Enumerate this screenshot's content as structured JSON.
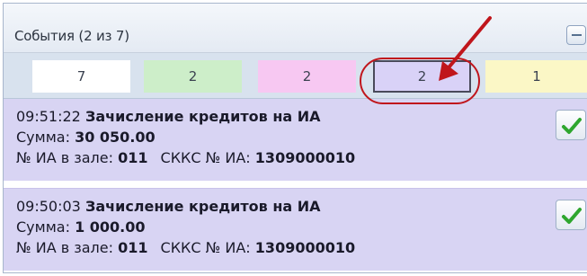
{
  "header": {
    "title": "События (2 из 7)"
  },
  "filters": [
    {
      "count": "7",
      "color": "#ffffff"
    },
    {
      "count": "2",
      "color": "#cdeec9"
    },
    {
      "count": "2",
      "color": "#f7c8f2"
    },
    {
      "count": "2",
      "color": "#d9d2f7"
    },
    {
      "count": "1",
      "color": "#fbf7c6"
    }
  ],
  "events": [
    {
      "time": "09:51:22",
      "title": "Зачисление кредитов на ИА",
      "sum_label": "Сумма:",
      "sum_value": "30 050.00",
      "hall_label": "№ ИА в зале:",
      "hall_value": "011",
      "skks_label": "СККС № ИА:",
      "skks_value": "1309000010"
    },
    {
      "time": "09:50:03",
      "title": "Зачисление кредитов на ИА",
      "sum_label": "Сумма:",
      "sum_value": "1 000.00",
      "hall_label": "№ ИА в зале:",
      "hall_value": "011",
      "skks_label": "СККС № ИА:",
      "skks_value": "1309000010"
    }
  ],
  "icons": {
    "collapse": "minus-icon",
    "confirm": "checkmark-icon",
    "annotation": "red-arrow"
  },
  "colors": {
    "event_bg": "#d8d4f3",
    "annotation": "#c0161c",
    "check": "#2ea62e"
  }
}
